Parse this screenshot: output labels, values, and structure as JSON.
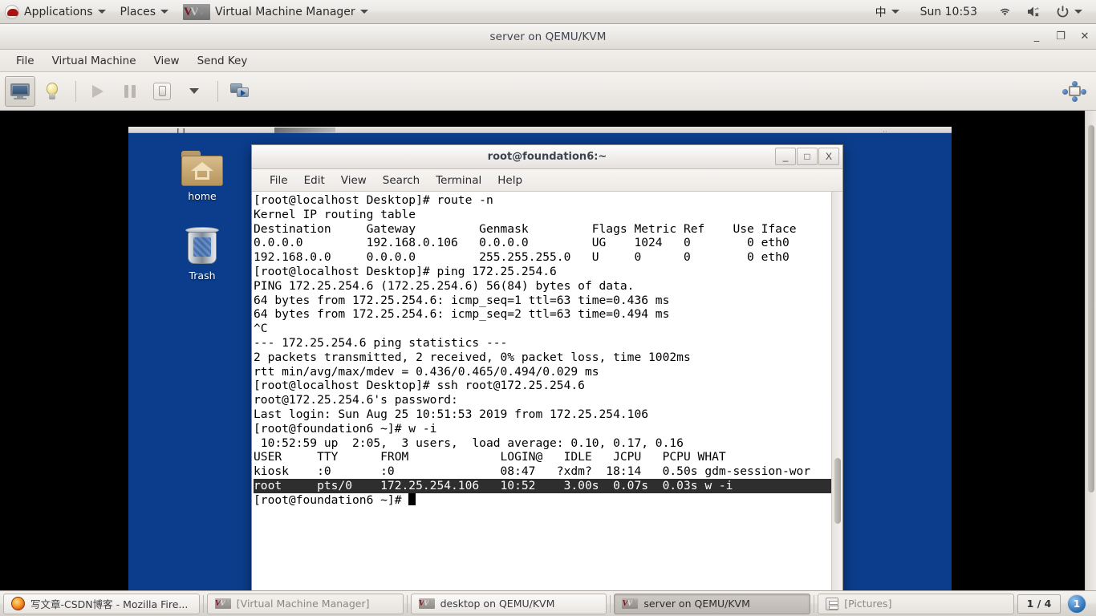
{
  "gnome_panel": {
    "applications_label": "Applications",
    "places_label": "Places",
    "app_title": "Virtual Machine Manager",
    "ime_label": "中",
    "clock": "Sun 10:53",
    "icons": [
      "redhat-icon",
      "vmm-logo-icon",
      "wifi-icon",
      "volume-muted-icon",
      "power-icon"
    ]
  },
  "vmm_window": {
    "title": "server on QEMU/KVM",
    "window_buttons": {
      "minimize": "_",
      "maximize": "❐",
      "close": "✕"
    },
    "menus": [
      "File",
      "Virtual Machine",
      "View",
      "Send Key"
    ],
    "toolbar": [
      {
        "name": "show-console-button",
        "icon": "monitor-icon",
        "state": "active"
      },
      {
        "name": "show-details-button",
        "icon": "lightbulb-icon",
        "state": "normal"
      },
      {
        "name": "run-button",
        "icon": "play-icon",
        "state": "disabled"
      },
      {
        "name": "pause-button",
        "icon": "pause-icon",
        "state": "disabled"
      },
      {
        "name": "shutdown-button",
        "icon": "power-switch-icon",
        "state": "normal"
      },
      {
        "name": "shutdown-menu-button",
        "icon": "chevron-down-icon",
        "state": "normal"
      },
      {
        "name": "snapshots-button",
        "icon": "screens-icon",
        "state": "normal"
      },
      {
        "name": "fullscreen-button",
        "icon": "fullscreen-icon",
        "state": "normal"
      }
    ]
  },
  "guest_desktop": {
    "background_color": "#0b3d8c",
    "icons": [
      {
        "name": "desktop-icon-home",
        "label": "home",
        "glyph": "home-folder-icon"
      },
      {
        "name": "desktop-icon-trash",
        "label": "Trash",
        "glyph": "trash-icon"
      }
    ]
  },
  "terminal": {
    "title": "root@foundation6:~",
    "window_buttons": {
      "minimize": "_",
      "maximize": "□",
      "close": "X"
    },
    "menus": [
      "File",
      "Edit",
      "View",
      "Search",
      "Terminal",
      "Help"
    ],
    "colors": {
      "background": "#ffffff",
      "foreground": "#000000",
      "selection_bg": "#2e2e2e",
      "selection_fg": "#ffffff"
    },
    "lines": [
      {
        "text": "[root@localhost Desktop]# route -n",
        "highlight": false
      },
      {
        "text": "Kernel IP routing table",
        "highlight": false
      },
      {
        "text": "Destination     Gateway         Genmask         Flags Metric Ref    Use Iface",
        "highlight": false
      },
      {
        "text": "0.0.0.0         192.168.0.106   0.0.0.0         UG    1024   0        0 eth0",
        "highlight": false
      },
      {
        "text": "192.168.0.0     0.0.0.0         255.255.255.0   U     0      0        0 eth0",
        "highlight": false
      },
      {
        "text": "[root@localhost Desktop]# ping 172.25.254.6",
        "highlight": false
      },
      {
        "text": "PING 172.25.254.6 (172.25.254.6) 56(84) bytes of data.",
        "highlight": false
      },
      {
        "text": "64 bytes from 172.25.254.6: icmp_seq=1 ttl=63 time=0.436 ms",
        "highlight": false
      },
      {
        "text": "64 bytes from 172.25.254.6: icmp_seq=2 ttl=63 time=0.494 ms",
        "highlight": false
      },
      {
        "text": "^C",
        "highlight": false
      },
      {
        "text": "--- 172.25.254.6 ping statistics ---",
        "highlight": false
      },
      {
        "text": "2 packets transmitted, 2 received, 0% packet loss, time 1002ms",
        "highlight": false
      },
      {
        "text": "rtt min/avg/max/mdev = 0.436/0.465/0.494/0.029 ms",
        "highlight": false
      },
      {
        "text": "[root@localhost Desktop]# ssh root@172.25.254.6",
        "highlight": false
      },
      {
        "text": "root@172.25.254.6's password:",
        "highlight": false
      },
      {
        "text": "Last login: Sun Aug 25 10:51:53 2019 from 172.25.254.106",
        "highlight": false
      },
      {
        "text": "[root@foundation6 ~]# w -i",
        "highlight": false
      },
      {
        "text": " 10:52:59 up  2:05,  3 users,  load average: 0.10, 0.17, 0.16",
        "highlight": false
      },
      {
        "text": "USER     TTY      FROM             LOGIN@   IDLE   JCPU   PCPU WHAT",
        "highlight": false
      },
      {
        "text": "kiosk    :0       :0               08:47   ?xdm?  18:14   0.50s gdm-session-wor",
        "highlight": false
      },
      {
        "text": "root     pts/0    172.25.254.106   10:52    3.00s  0.07s  0.03s w -i",
        "highlight": true
      }
    ],
    "prompt": "[root@foundation6 ~]# "
  },
  "taskbar": {
    "tasks": [
      {
        "label": "写文章-CSDN博客 - Mozilla Fire...",
        "icon": "firefox-icon",
        "state": "normal"
      },
      {
        "label": "[Virtual Machine Manager]",
        "icon": "vmm-icon",
        "state": "minimized"
      },
      {
        "label": "desktop on QEMU/KVM",
        "icon": "vmm-icon",
        "state": "normal"
      },
      {
        "label": "server on QEMU/KVM",
        "icon": "vmm-icon",
        "state": "active"
      },
      {
        "label": "[Pictures]",
        "icon": "files-icon",
        "state": "minimized"
      }
    ],
    "pager_label": "1 / 4",
    "workspace_badge": "1"
  }
}
